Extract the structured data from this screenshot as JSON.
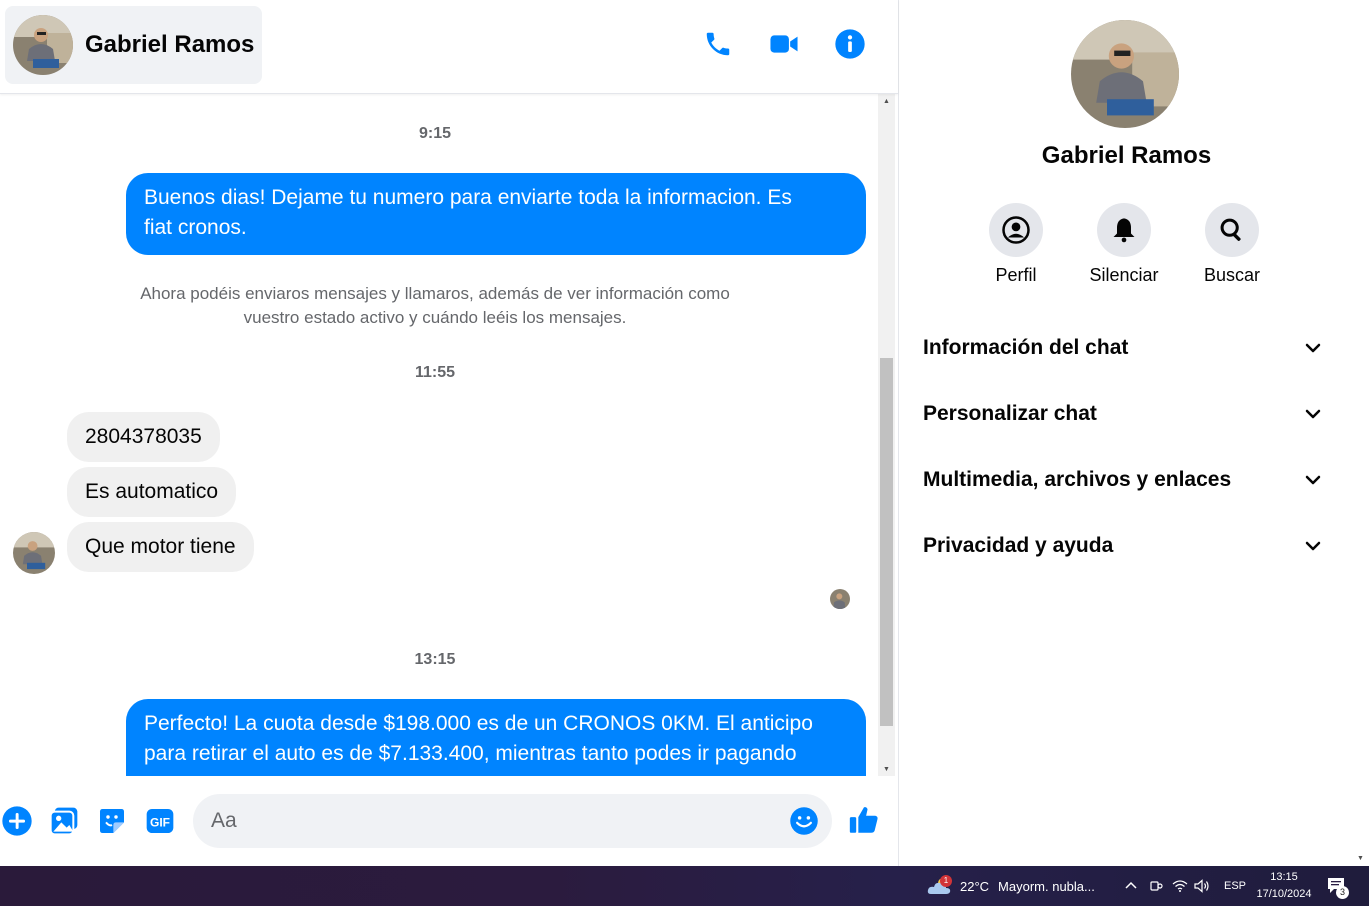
{
  "colors": {
    "accent": "#0084ff",
    "bubble_in": "#f0f0f0",
    "muted_text": "#65676b"
  },
  "contact": {
    "name": "Gabriel Ramos"
  },
  "header_icons": [
    "phone-icon",
    "video-camera-icon",
    "info-icon"
  ],
  "messages": [
    {
      "type": "timestamp",
      "text": "9:15"
    },
    {
      "type": "outgoing",
      "lines": [
        "Buenos dias! Dejame tu numero para enviarte toda la informacion. Es",
        "fiat cronos."
      ]
    },
    {
      "type": "notice",
      "lines": [
        "Ahora podéis enviaros mensajes y llamaros, además de ver información como",
        "vuestro estado activo y cuándo leéis los mensajes."
      ]
    },
    {
      "type": "timestamp",
      "text": "11:55"
    },
    {
      "type": "incoming",
      "text": "2804378035"
    },
    {
      "type": "incoming",
      "text": "Es automatico"
    },
    {
      "type": "incoming",
      "text": "Que motor tiene"
    },
    {
      "type": "timestamp",
      "text": "13:15"
    },
    {
      "type": "outgoing",
      "lines": [
        "Perfecto! La cuota desde $198.000 es de un CRONOS 0KM. El anticipo",
        "para retirar el auto es de $7.133.400, mientras tanto podes ir pagando"
      ]
    }
  ],
  "composer": {
    "placeholder": "Aa",
    "icons": [
      "plus-circle-icon",
      "photo-icon",
      "sticker-icon",
      "gif-icon",
      "emoji-icon",
      "thumbs-up-icon"
    ]
  },
  "info_panel": {
    "name": "Gabriel Ramos",
    "actions": [
      {
        "label": "Perfil",
        "icon": "profile-icon"
      },
      {
        "label": "Silenciar",
        "icon": "bell-icon"
      },
      {
        "label": "Buscar",
        "icon": "search-icon"
      }
    ],
    "sections": [
      "Información del chat",
      "Personalizar chat",
      "Multimedia, archivos y enlaces",
      "Privacidad y ayuda"
    ]
  },
  "taskbar": {
    "weather_badge": "1",
    "temperature": "22°C",
    "weather_text": "Mayorm. nubla...",
    "language": "ESP",
    "time": "13:15",
    "date": "17/10/2024",
    "notification_count": "3"
  }
}
